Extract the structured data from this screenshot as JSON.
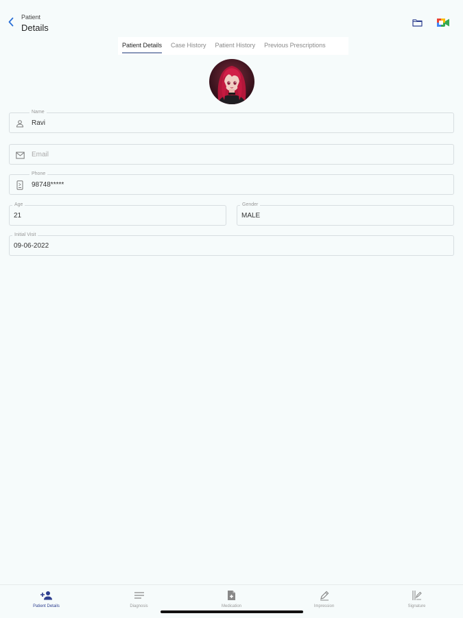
{
  "header": {
    "subtitle": "Patient",
    "title": "Details",
    "icons": [
      "back-chevron-icon",
      "folder-icon",
      "video-call-icon"
    ]
  },
  "tabs": [
    {
      "label": "Patient Details",
      "active": true
    },
    {
      "label": "Case History",
      "active": false
    },
    {
      "label": "Patient History",
      "active": false
    },
    {
      "label": "Previous Prescriptions",
      "active": false
    }
  ],
  "form": {
    "name": {
      "label": "Name",
      "value": "Ravi",
      "icon": "person-icon"
    },
    "email": {
      "label": "",
      "placeholder": "Email",
      "value": "",
      "icon": "mail-icon"
    },
    "phone": {
      "label": "Phone",
      "value": "98748*****",
      "icon": "phone-icon"
    },
    "age": {
      "label": "Age",
      "value": "21"
    },
    "gender": {
      "label": "Gender",
      "value": "MALE"
    },
    "initial_visit": {
      "label": "Initial Visit",
      "value": "09-06-2022"
    }
  },
  "bottom_nav": [
    {
      "label": "Patient Details",
      "icon": "person-add-icon",
      "active": true
    },
    {
      "label": "Diagnosis",
      "icon": "lines-icon",
      "active": false
    },
    {
      "label": "Medication",
      "icon": "medical-file-icon",
      "active": false
    },
    {
      "label": "Impression",
      "icon": "pen-icon",
      "active": false
    },
    {
      "label": "Signature",
      "icon": "signature-icon",
      "active": false
    }
  ],
  "colors": {
    "accent": "#2e3f8f",
    "back_arrow": "#2a6fd6",
    "background": "#f6fbfb",
    "tab_indicator": "#8796b8"
  }
}
